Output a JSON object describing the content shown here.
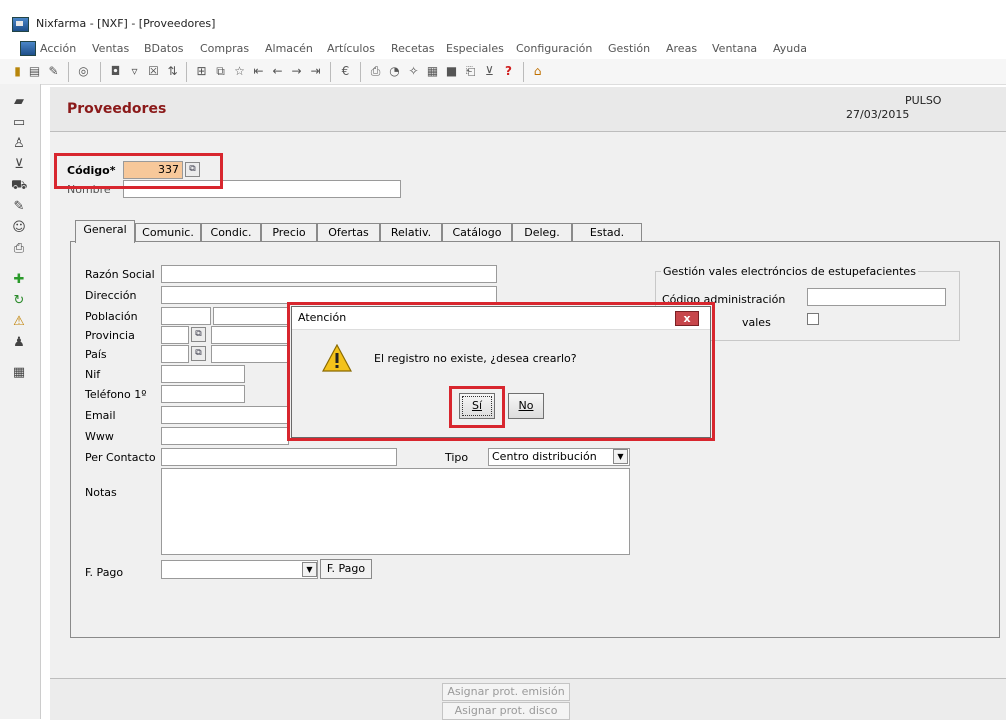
{
  "window": {
    "title": "Nixfarma - [NXF] - [Proveedores]"
  },
  "menu": [
    "Acción",
    "Ventas",
    "BDatos",
    "Compras",
    "Almacén",
    "Artículos",
    "Recetas",
    "Especiales",
    "Configuración",
    "Gestión",
    "Areas",
    "Ventana",
    "Ayuda"
  ],
  "header": {
    "title": "Proveedores",
    "user": "PULSO",
    "date": "27/03/2015"
  },
  "form": {
    "codigo_label": "Código*",
    "codigo_value": "337",
    "nombre_label": "Nombre"
  },
  "tabs": [
    "General",
    "Comunic.",
    "Condic.",
    "Precio",
    "Ofertas",
    "Relativ.",
    "Catálogo",
    "Deleg.",
    "Estad."
  ],
  "general": {
    "labels": {
      "razon": "Razón Social",
      "direccion": "Dirección",
      "poblacion": "Población",
      "provincia": "Provincia",
      "pais": "País",
      "nif": "Nif",
      "telefono": "Teléfono 1º",
      "email": "Email",
      "www": "Www",
      "contacto": "Per Contacto",
      "tipo": "Tipo",
      "notas": "Notas",
      "fpago": "F. Pago"
    },
    "tipo_value": "Centro distribución",
    "fpago_button": "F. Pago",
    "vales": {
      "title": "Gestión vales electróncios de estupefacientes",
      "codigo_label": "Código administración",
      "vales_label": "vales"
    }
  },
  "bottom": {
    "btn1": "Asignar prot. emisión",
    "btn2": "Asignar prot. disco"
  },
  "dialog": {
    "title": "Atención",
    "close": "x",
    "message": "El registro no existe, ¿desea crearlo?",
    "yes": "Sí",
    "no": "No"
  },
  "colors": {
    "highlight": "#d8262e",
    "code_field": "#f7c89a",
    "title": "#8b1a1a"
  }
}
